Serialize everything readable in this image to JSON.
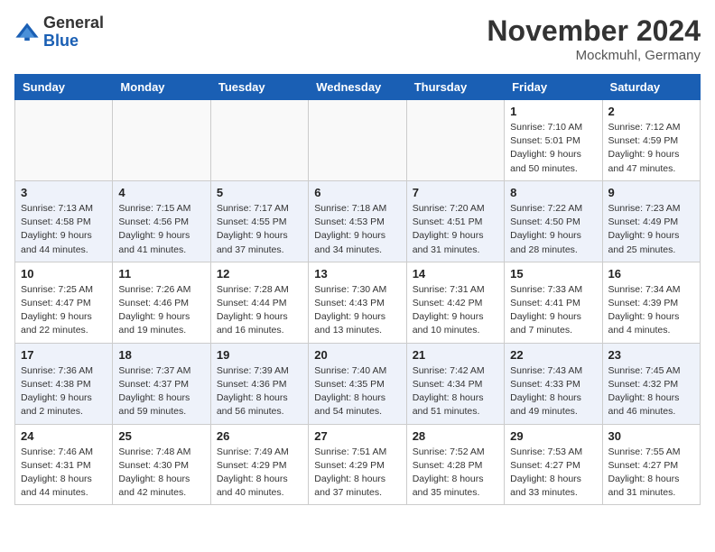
{
  "logo": {
    "text_general": "General",
    "text_blue": "Blue"
  },
  "header": {
    "month": "November 2024",
    "location": "Mockmuhl, Germany"
  },
  "weekdays": [
    "Sunday",
    "Monday",
    "Tuesday",
    "Wednesday",
    "Thursday",
    "Friday",
    "Saturday"
  ],
  "weeks": [
    [
      {
        "day": "",
        "info": ""
      },
      {
        "day": "",
        "info": ""
      },
      {
        "day": "",
        "info": ""
      },
      {
        "day": "",
        "info": ""
      },
      {
        "day": "",
        "info": ""
      },
      {
        "day": "1",
        "info": "Sunrise: 7:10 AM\nSunset: 5:01 PM\nDaylight: 9 hours and 50 minutes."
      },
      {
        "day": "2",
        "info": "Sunrise: 7:12 AM\nSunset: 4:59 PM\nDaylight: 9 hours and 47 minutes."
      }
    ],
    [
      {
        "day": "3",
        "info": "Sunrise: 7:13 AM\nSunset: 4:58 PM\nDaylight: 9 hours and 44 minutes."
      },
      {
        "day": "4",
        "info": "Sunrise: 7:15 AM\nSunset: 4:56 PM\nDaylight: 9 hours and 41 minutes."
      },
      {
        "day": "5",
        "info": "Sunrise: 7:17 AM\nSunset: 4:55 PM\nDaylight: 9 hours and 37 minutes."
      },
      {
        "day": "6",
        "info": "Sunrise: 7:18 AM\nSunset: 4:53 PM\nDaylight: 9 hours and 34 minutes."
      },
      {
        "day": "7",
        "info": "Sunrise: 7:20 AM\nSunset: 4:51 PM\nDaylight: 9 hours and 31 minutes."
      },
      {
        "day": "8",
        "info": "Sunrise: 7:22 AM\nSunset: 4:50 PM\nDaylight: 9 hours and 28 minutes."
      },
      {
        "day": "9",
        "info": "Sunrise: 7:23 AM\nSunset: 4:49 PM\nDaylight: 9 hours and 25 minutes."
      }
    ],
    [
      {
        "day": "10",
        "info": "Sunrise: 7:25 AM\nSunset: 4:47 PM\nDaylight: 9 hours and 22 minutes."
      },
      {
        "day": "11",
        "info": "Sunrise: 7:26 AM\nSunset: 4:46 PM\nDaylight: 9 hours and 19 minutes."
      },
      {
        "day": "12",
        "info": "Sunrise: 7:28 AM\nSunset: 4:44 PM\nDaylight: 9 hours and 16 minutes."
      },
      {
        "day": "13",
        "info": "Sunrise: 7:30 AM\nSunset: 4:43 PM\nDaylight: 9 hours and 13 minutes."
      },
      {
        "day": "14",
        "info": "Sunrise: 7:31 AM\nSunset: 4:42 PM\nDaylight: 9 hours and 10 minutes."
      },
      {
        "day": "15",
        "info": "Sunrise: 7:33 AM\nSunset: 4:41 PM\nDaylight: 9 hours and 7 minutes."
      },
      {
        "day": "16",
        "info": "Sunrise: 7:34 AM\nSunset: 4:39 PM\nDaylight: 9 hours and 4 minutes."
      }
    ],
    [
      {
        "day": "17",
        "info": "Sunrise: 7:36 AM\nSunset: 4:38 PM\nDaylight: 9 hours and 2 minutes."
      },
      {
        "day": "18",
        "info": "Sunrise: 7:37 AM\nSunset: 4:37 PM\nDaylight: 8 hours and 59 minutes."
      },
      {
        "day": "19",
        "info": "Sunrise: 7:39 AM\nSunset: 4:36 PM\nDaylight: 8 hours and 56 minutes."
      },
      {
        "day": "20",
        "info": "Sunrise: 7:40 AM\nSunset: 4:35 PM\nDaylight: 8 hours and 54 minutes."
      },
      {
        "day": "21",
        "info": "Sunrise: 7:42 AM\nSunset: 4:34 PM\nDaylight: 8 hours and 51 minutes."
      },
      {
        "day": "22",
        "info": "Sunrise: 7:43 AM\nSunset: 4:33 PM\nDaylight: 8 hours and 49 minutes."
      },
      {
        "day": "23",
        "info": "Sunrise: 7:45 AM\nSunset: 4:32 PM\nDaylight: 8 hours and 46 minutes."
      }
    ],
    [
      {
        "day": "24",
        "info": "Sunrise: 7:46 AM\nSunset: 4:31 PM\nDaylight: 8 hours and 44 minutes."
      },
      {
        "day": "25",
        "info": "Sunrise: 7:48 AM\nSunset: 4:30 PM\nDaylight: 8 hours and 42 minutes."
      },
      {
        "day": "26",
        "info": "Sunrise: 7:49 AM\nSunset: 4:29 PM\nDaylight: 8 hours and 40 minutes."
      },
      {
        "day": "27",
        "info": "Sunrise: 7:51 AM\nSunset: 4:29 PM\nDaylight: 8 hours and 37 minutes."
      },
      {
        "day": "28",
        "info": "Sunrise: 7:52 AM\nSunset: 4:28 PM\nDaylight: 8 hours and 35 minutes."
      },
      {
        "day": "29",
        "info": "Sunrise: 7:53 AM\nSunset: 4:27 PM\nDaylight: 8 hours and 33 minutes."
      },
      {
        "day": "30",
        "info": "Sunrise: 7:55 AM\nSunset: 4:27 PM\nDaylight: 8 hours and 31 minutes."
      }
    ]
  ]
}
